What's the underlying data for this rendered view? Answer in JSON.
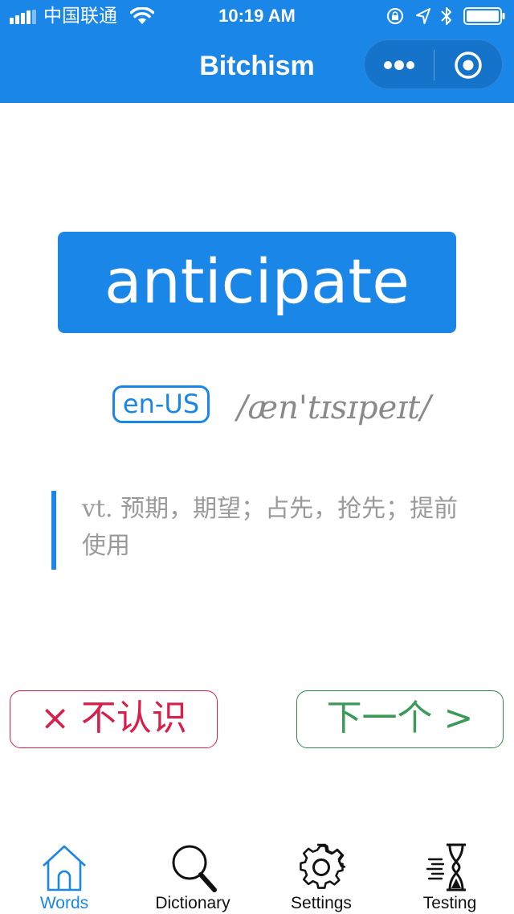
{
  "status_bar": {
    "carrier": "中国联通",
    "time": "10:19 AM"
  },
  "nav": {
    "title": "Bitchism",
    "menu_icon": "more-dots-icon",
    "close_icon": "target-close-icon"
  },
  "word": {
    "text": "anticipate",
    "locale": "en-US",
    "phonetic": "/æn'tɪsɪpeɪt/",
    "part_of_speech": "vt.",
    "definition": "预期，期望；占先，抢先；提前使用"
  },
  "actions": {
    "unknown_label": "× 不认识",
    "next_label": "下一个 >"
  },
  "tabs": [
    {
      "label": "Words",
      "icon": "home-icon",
      "active": true
    },
    {
      "label": "Dictionary",
      "icon": "magnifier-icon",
      "active": false
    },
    {
      "label": "Settings",
      "icon": "gear-icon",
      "active": false
    },
    {
      "label": "Testing",
      "icon": "hourglass-icon",
      "active": false
    }
  ],
  "colors": {
    "primary": "#1a86e8",
    "unknown": "#d81e4b",
    "next": "#3b9a58",
    "muted_text": "#9a9a9a"
  }
}
